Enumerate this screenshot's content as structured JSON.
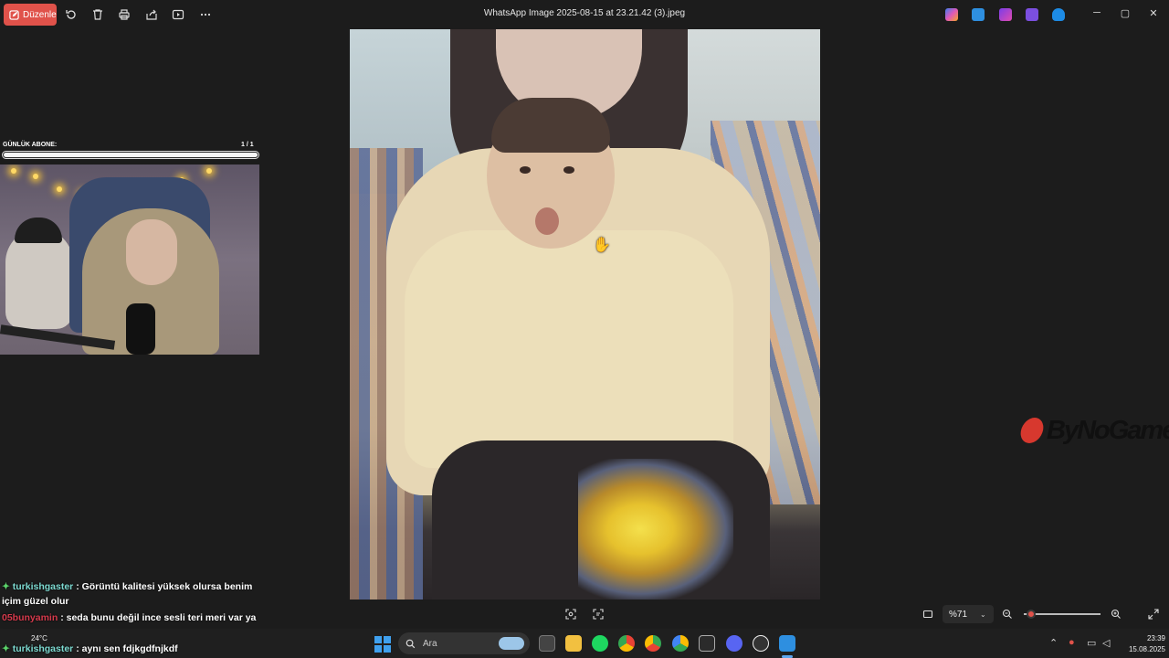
{
  "toolbar": {
    "edit_label": "Düzenle",
    "icons": [
      "rotate-icon",
      "delete-icon",
      "print-icon",
      "share-icon",
      "slideshow-icon",
      "more-icon"
    ]
  },
  "window": {
    "title": "WhatsApp Image 2025-08-15 at 23.21.42 (3).jpeg",
    "controls": {
      "minimize": "─",
      "maximize": "▢",
      "close": "✕"
    }
  },
  "overlay": {
    "subscriber_label": "GÜNLÜK ABONE:",
    "subscriber_count": "1  / 1",
    "subscriber_progress": 1.0
  },
  "chat": [
    {
      "badge": "✦",
      "user": "turkishgaster",
      "user_style": "u1",
      "text": ": Görüntü kalitesi yüksek olursa benim içim güzel olur"
    },
    {
      "badge": "",
      "user": "05bunyamin",
      "user_style": "u2",
      "text": ": seda bunu değil ince sesli teri meri var ya onu ac"
    },
    {
      "badge": "✦",
      "user": "turkishgaster",
      "user_style": "u1",
      "text": ": aynı sen fdjkgdfnjkdf"
    }
  ],
  "viewer": {
    "zoom_value": "%71",
    "zoom_level": 0.1
  },
  "watermark": {
    "text": "ByNoGame"
  },
  "taskbar": {
    "search_placeholder": "Ara",
    "weather": "24°C",
    "time": "23:39",
    "date": "15.08.2025"
  },
  "colors": {
    "accent": "#e0524a",
    "background": "#1c1c1c",
    "taskbar": "#1f1f1f",
    "windows_blue": "#3fa0ee"
  }
}
